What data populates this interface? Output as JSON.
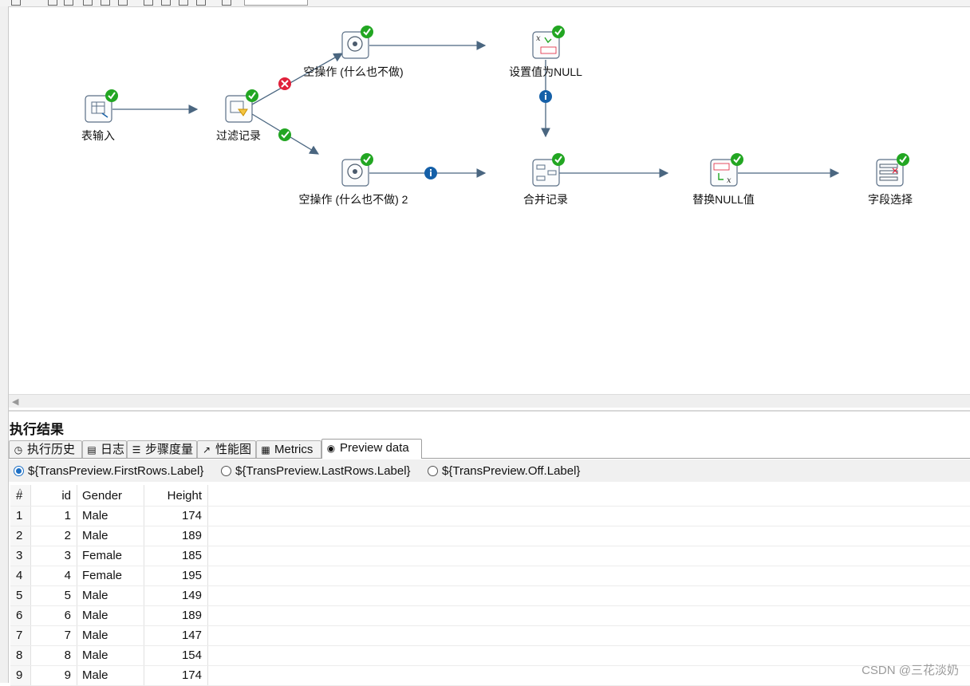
{
  "canvas": {
    "steps": [
      {
        "id": "table-input",
        "label": "表输入"
      },
      {
        "id": "filter-rows",
        "label": "过滤记录"
      },
      {
        "id": "dummy-1",
        "label": "空操作 (什么也不做)"
      },
      {
        "id": "dummy-2",
        "label": "空操作 (什么也不做) 2"
      },
      {
        "id": "set-null",
        "label": "设置值为NULL"
      },
      {
        "id": "merge-rows",
        "label": "合并记录"
      },
      {
        "id": "replace-null",
        "label": "替换NULL值"
      },
      {
        "id": "select-values",
        "label": "字段选择"
      }
    ],
    "icons": {
      "table-input": "table-input-icon",
      "filter-rows": "filter-rows-icon",
      "dummy": "dummy-head-icon",
      "set-null": "set-null-icon",
      "merge-rows": "merge-rows-icon",
      "replace-null": "replace-null-icon",
      "select-values": "select-values-icon",
      "status": "success-check-icon",
      "hop-true": "true-check-icon",
      "hop-false": "false-x-icon",
      "hop-info": "info-icon"
    },
    "colors": {
      "success": "#22a622",
      "error": "#e0203a",
      "info": "#1560a8",
      "hop": "#4a6680"
    }
  },
  "results": {
    "title": "执行结果",
    "tabs": [
      {
        "label": "执行历史",
        "icon": "history-icon"
      },
      {
        "label": "日志",
        "icon": "log-icon"
      },
      {
        "label": "步骤度量",
        "icon": "step-metrics-icon"
      },
      {
        "label": "性能图",
        "icon": "performance-chart-icon"
      },
      {
        "label": "Metrics",
        "icon": "metrics-icon"
      },
      {
        "label": "Preview data",
        "icon": "preview-eye-icon",
        "active": true
      }
    ],
    "radios": [
      {
        "label": "${TransPreview.FirstRows.Label}",
        "selected": true
      },
      {
        "label": "${TransPreview.LastRows.Label}",
        "selected": false
      },
      {
        "label": "${TransPreview.Off.Label}",
        "selected": false
      }
    ],
    "table": {
      "columns": [
        "#",
        "id",
        "Gender",
        "Height"
      ],
      "rows": [
        [
          "1",
          "1",
          "Male",
          "174"
        ],
        [
          "2",
          "2",
          "Male",
          "189"
        ],
        [
          "3",
          "3",
          "Female",
          "185"
        ],
        [
          "4",
          "4",
          "Female",
          "195"
        ],
        [
          "5",
          "5",
          "Male",
          "149"
        ],
        [
          "6",
          "6",
          "Male",
          "189"
        ],
        [
          "7",
          "7",
          "Male",
          "147"
        ],
        [
          "8",
          "8",
          "Male",
          "154"
        ],
        [
          "9",
          "9",
          "Male",
          "174"
        ]
      ]
    }
  },
  "watermark": "CSDN @三花淡奶"
}
